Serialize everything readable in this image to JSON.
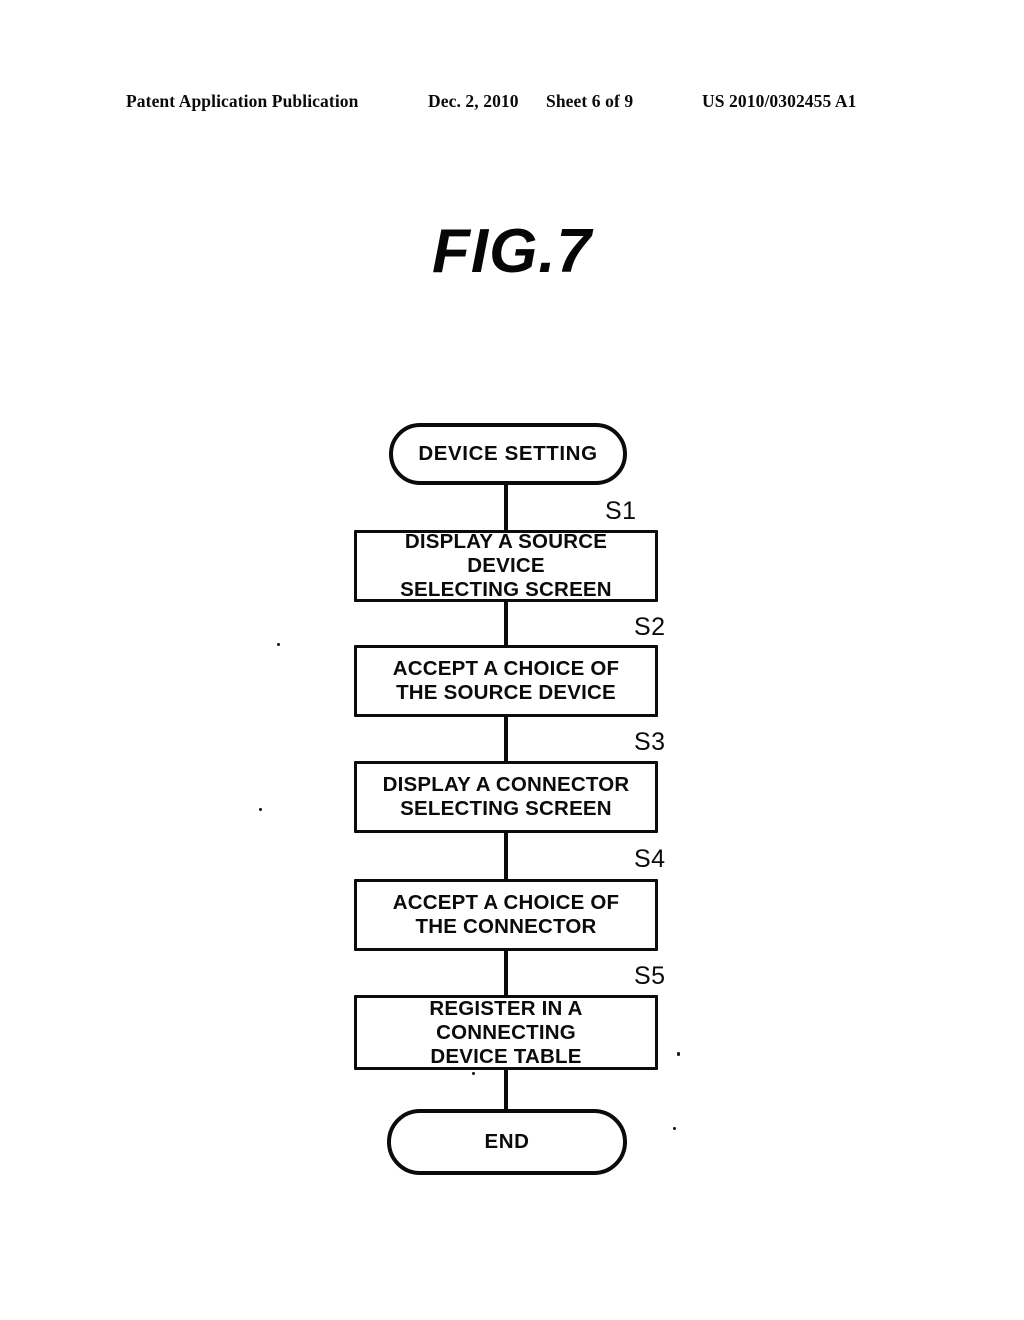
{
  "header": {
    "publication": "Patent Application Publication",
    "date": "Dec. 2, 2010",
    "sheet": "Sheet 6 of 9",
    "number": "US 2010/0302455 A1"
  },
  "figure": {
    "title": "FIG.7"
  },
  "flowchart": {
    "start": {
      "label": "DEVICE SETTING",
      "shape": "terminal"
    },
    "end": {
      "label": "END",
      "shape": "terminal"
    },
    "steps": [
      {
        "id": "S1",
        "line1": "DISPLAY A SOURCE DEVICE",
        "line2": "SELECTING SCREEN"
      },
      {
        "id": "S2",
        "line1": "ACCEPT A CHOICE OF",
        "line2": "THE SOURCE DEVICE"
      },
      {
        "id": "S3",
        "line1": "DISPLAY A CONNECTOR",
        "line2": "SELECTING SCREEN"
      },
      {
        "id": "S4",
        "line1": "ACCEPT A CHOICE OF",
        "line2": "THE CONNECTOR"
      },
      {
        "id": "S5",
        "line1": "REGISTER IN A CONNECTING",
        "line2": "DEVICE TABLE"
      }
    ]
  },
  "colors": {
    "ink": "#0b0b0b",
    "paper": "#ffffff"
  }
}
